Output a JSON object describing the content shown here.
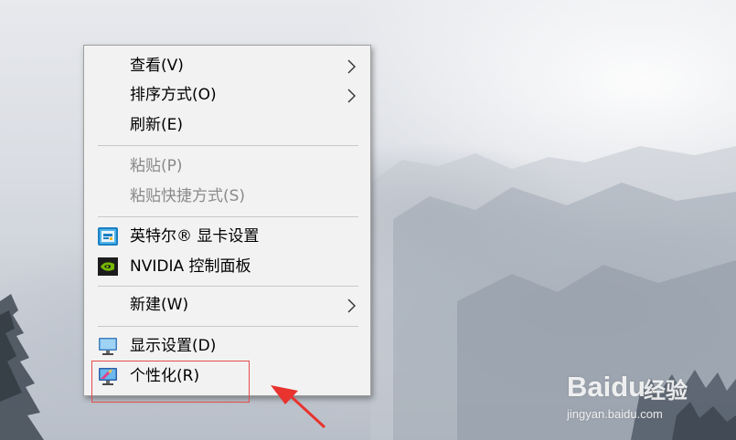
{
  "context_menu": {
    "items": [
      {
        "label": "查看(V)",
        "disabled": false,
        "submenu": true
      },
      {
        "label": "排序方式(O)",
        "disabled": false,
        "submenu": true
      },
      {
        "label": "刷新(E)",
        "disabled": false,
        "submenu": false
      },
      {
        "label": "粘贴(P)",
        "disabled": true,
        "submenu": false
      },
      {
        "label": "粘贴快捷方式(S)",
        "disabled": true,
        "submenu": false
      },
      {
        "label": "英特尔® 显卡设置",
        "disabled": false,
        "submenu": false,
        "icon": "intel-graphics-icon"
      },
      {
        "label": "NVIDIA 控制面板",
        "disabled": false,
        "submenu": false,
        "icon": "nvidia-icon"
      },
      {
        "label": "新建(W)",
        "disabled": false,
        "submenu": true
      },
      {
        "label": "显示设置(D)",
        "disabled": false,
        "submenu": false,
        "icon": "display-settings-icon"
      },
      {
        "label": "个性化(R)",
        "disabled": false,
        "submenu": false,
        "icon": "personalize-icon"
      }
    ]
  },
  "annotation": {
    "highlight_color": "#e84a4a",
    "arrow_color": "#e8332e"
  },
  "watermark": {
    "brand": "Baidu",
    "suffix": "经验",
    "url": "jingyan.baidu.com"
  }
}
